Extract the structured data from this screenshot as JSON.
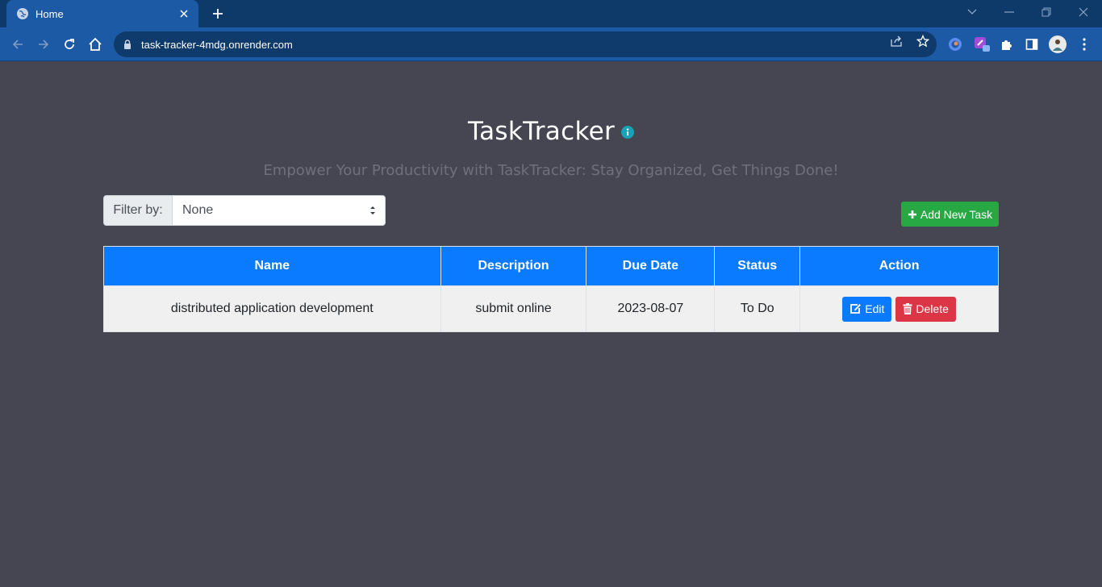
{
  "browser": {
    "tab_title": "Home",
    "url": "task-tracker-4mdg.onrender.com"
  },
  "header": {
    "title": "TaskTracker",
    "subtitle": "Empower Your Productivity with TaskTracker: Stay Organized, Get Things Done!"
  },
  "filter": {
    "label": "Filter by:",
    "selected": "None"
  },
  "add_button_label": "Add New Task",
  "table": {
    "columns": [
      "Name",
      "Description",
      "Due Date",
      "Status",
      "Action"
    ],
    "rows": [
      {
        "name": "distributed application development",
        "description": "submit online",
        "due_date": "2023-08-07",
        "status": "To Do",
        "edit_label": "Edit",
        "delete_label": "Delete"
      }
    ]
  },
  "colors": {
    "page_bg": "#454652",
    "primary": "#0a7bff",
    "success": "#28a745",
    "danger": "#dc3545",
    "info": "#17a2b8"
  }
}
